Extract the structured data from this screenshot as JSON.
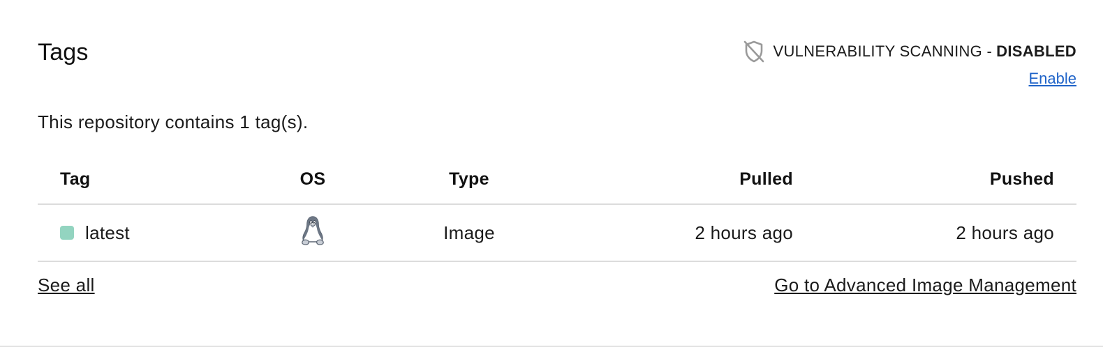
{
  "section": {
    "title": "Tags"
  },
  "vulnerability": {
    "label": "VULNERABILITY SCANNING - ",
    "status": "DISABLED",
    "enable_link": "Enable",
    "icon": "shield-slash-icon"
  },
  "summary": "This repository contains 1 tag(s).",
  "table": {
    "headers": {
      "tag": "Tag",
      "os": "OS",
      "type": "Type",
      "pulled": "Pulled",
      "pushed": "Pushed"
    },
    "rows": [
      {
        "tag": "latest",
        "os_icon": "linux-tux-icon",
        "type": "Image",
        "pulled": "2 hours ago",
        "pushed": "2 hours ago",
        "status_color": "#93d4c0"
      }
    ]
  },
  "footer": {
    "see_all": "See all",
    "advanced": "Go to Advanced Image Management"
  },
  "colors": {
    "link": "#1f63c8",
    "text": "#1b1b1b",
    "divider": "#dcdcdc",
    "tag_indicator": "#93d4c0"
  }
}
